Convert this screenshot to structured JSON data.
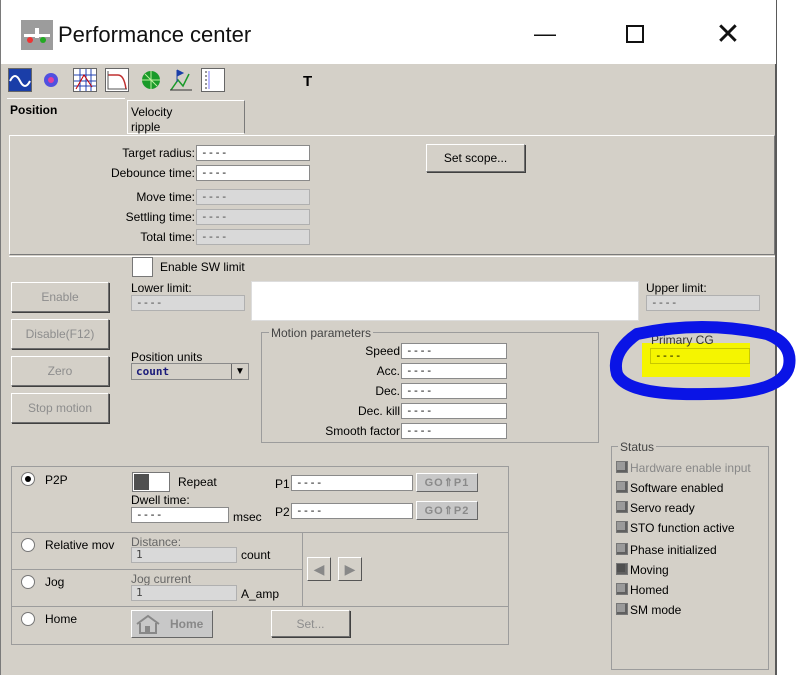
{
  "window": {
    "title": "Performance center",
    "controls": [
      "minimize-icon",
      "maximize-icon",
      "close-icon"
    ]
  },
  "toolbar": {
    "text_tool_label": "T"
  },
  "tabs": [
    {
      "label": "Position"
    },
    {
      "label": "Velocity\nripple"
    }
  ],
  "position": {
    "target_radius_label": "Target radius:",
    "target_radius_value": "----",
    "debounce_time_label": "Debounce time:",
    "debounce_time_value": "----",
    "move_time_label": "Move time:",
    "move_time_value": "----",
    "settling_time_label": "Settling time:",
    "settling_time_value": "----",
    "total_time_label": "Total time:",
    "total_time_value": "----",
    "set_scope_label": "Set scope..."
  },
  "limits": {
    "enable_sw_limit_label": "Enable SW limit",
    "lower_limit_label": "Lower limit:",
    "lower_limit_value": "----",
    "upper_limit_label": "Upper limit:",
    "upper_limit_value": "----"
  },
  "actions": {
    "enable": "Enable",
    "disable": "Disable(F12)",
    "zero": "Zero",
    "stop": "Stop motion"
  },
  "position_units": {
    "label": "Position units",
    "value": "count"
  },
  "motion_parameters": {
    "title": "Motion parameters",
    "rows": [
      {
        "label": "Speed",
        "value": "----"
      },
      {
        "label": "Acc.",
        "value": "----"
      },
      {
        "label": "Dec.",
        "value": "----"
      },
      {
        "label": "Dec. kill",
        "value": "----"
      },
      {
        "label": "Smooth factor",
        "value": "----"
      }
    ]
  },
  "primary_cg": {
    "label": "Primary CG",
    "value": "----",
    "highlight_color": "#f5f500",
    "circle_color": "#0a14e6"
  },
  "modes": {
    "p2p": {
      "label": "P2P",
      "repeat_label": "Repeat",
      "dwell_label": "Dwell time:",
      "dwell_value": "----",
      "dwell_unit": "msec",
      "p1_label": "P1",
      "p1_value": "----",
      "p2_label": "P2",
      "p2_value": "----",
      "go_p1": "GO⇑P1",
      "go_p2": "GO⇑P2"
    },
    "relative": {
      "label": "Relative mov",
      "distance_label": "Distance:",
      "distance_value": "1",
      "distance_unit": "count"
    },
    "jog": {
      "label": "Jog",
      "jog_current_label": "Jog current",
      "jog_current_value": "1",
      "jog_current_unit": "A_amp"
    },
    "home": {
      "label": "Home",
      "home_button": "Home",
      "set_button": "Set..."
    }
  },
  "status": {
    "title": "Status",
    "items": [
      {
        "label": "Hardware enable input",
        "dim": true
      },
      {
        "label": "Software enabled",
        "dim": false
      },
      {
        "label": "Servo ready",
        "dim": false
      },
      {
        "label": "STO function active",
        "dim": false
      },
      {
        "label": "Phase initialized",
        "dim": false
      },
      {
        "label": "Moving",
        "dim": false
      },
      {
        "label": "Homed",
        "dim": false
      },
      {
        "label": "SM mode",
        "dim": false
      }
    ]
  }
}
